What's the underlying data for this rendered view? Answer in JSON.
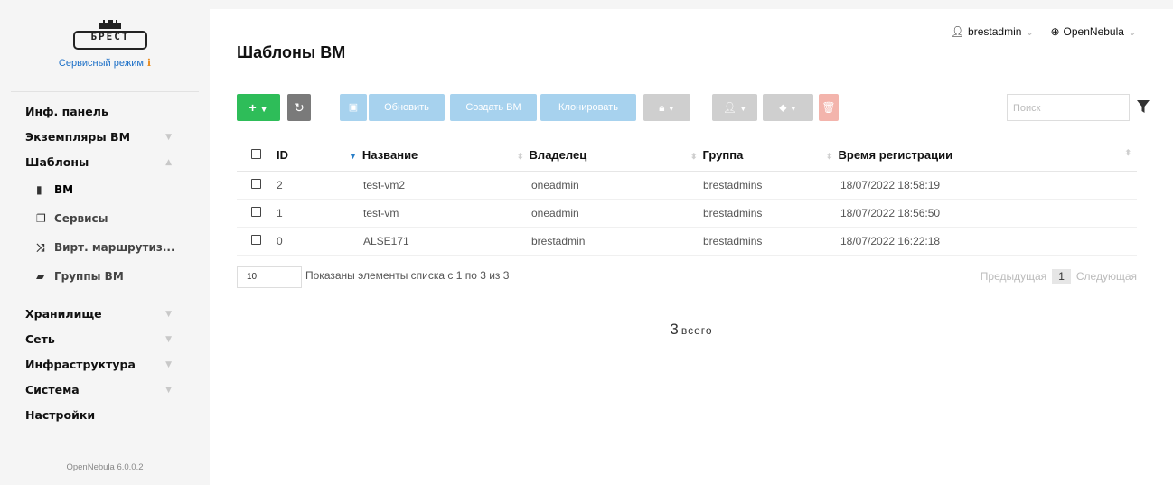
{
  "sidebar": {
    "logo_text": "БРЕСТ",
    "mode": "Сервисный режим",
    "items": [
      {
        "label": "Инф. панель"
      },
      {
        "label": "Экземпляры ВМ"
      },
      {
        "label": "Шаблоны"
      }
    ],
    "subitems": [
      {
        "label": "ВМ"
      },
      {
        "label": "Сервисы"
      },
      {
        "label": "Вирт. маршрутиз..."
      },
      {
        "label": "Группы ВМ"
      }
    ],
    "items2": [
      {
        "label": "Хранилище"
      },
      {
        "label": "Сеть"
      },
      {
        "label": "Инфраструктура"
      },
      {
        "label": "Система"
      },
      {
        "label": "Настройки"
      }
    ],
    "version": "OpenNebula 6.0.0.2"
  },
  "header": {
    "title": "Шаблоны ВМ",
    "user": "brestadmin",
    "zone": "OpenNebula"
  },
  "toolbar": {
    "update_label": "Обновить",
    "create_vm_label": "Создать ВМ",
    "clone_label": "Клонировать",
    "search_placeholder": "Поиск"
  },
  "table": {
    "columns": [
      "ID",
      "Название",
      "Владелец",
      "Группа",
      "Время регистрации"
    ],
    "rows": [
      {
        "id": "2",
        "name": "test-vm2",
        "owner": "oneadmin",
        "group": "brestadmins",
        "time": "18/07/2022 18:58:19"
      },
      {
        "id": "1",
        "name": "test-vm",
        "owner": "oneadmin",
        "group": "brestadmins",
        "time": "18/07/2022 18:56:50"
      },
      {
        "id": "0",
        "name": "ALSE171",
        "owner": "brestadmin",
        "group": "brestadmins",
        "time": "18/07/2022 16:22:18"
      }
    ]
  },
  "footer": {
    "page_length": "10",
    "info": "Показаны элементы списка с 1 по 3 из 3",
    "prev": "Предыдущая",
    "page": "1",
    "next": "Следующая"
  },
  "summary": {
    "count": "3",
    "label": "всего"
  },
  "colors": {
    "green": "#2ebd59",
    "blue_disabled": "#a7d2ee",
    "red_disabled": "#f3b4ac",
    "link": "#1b6fc7",
    "accent": "#e88b1e"
  }
}
